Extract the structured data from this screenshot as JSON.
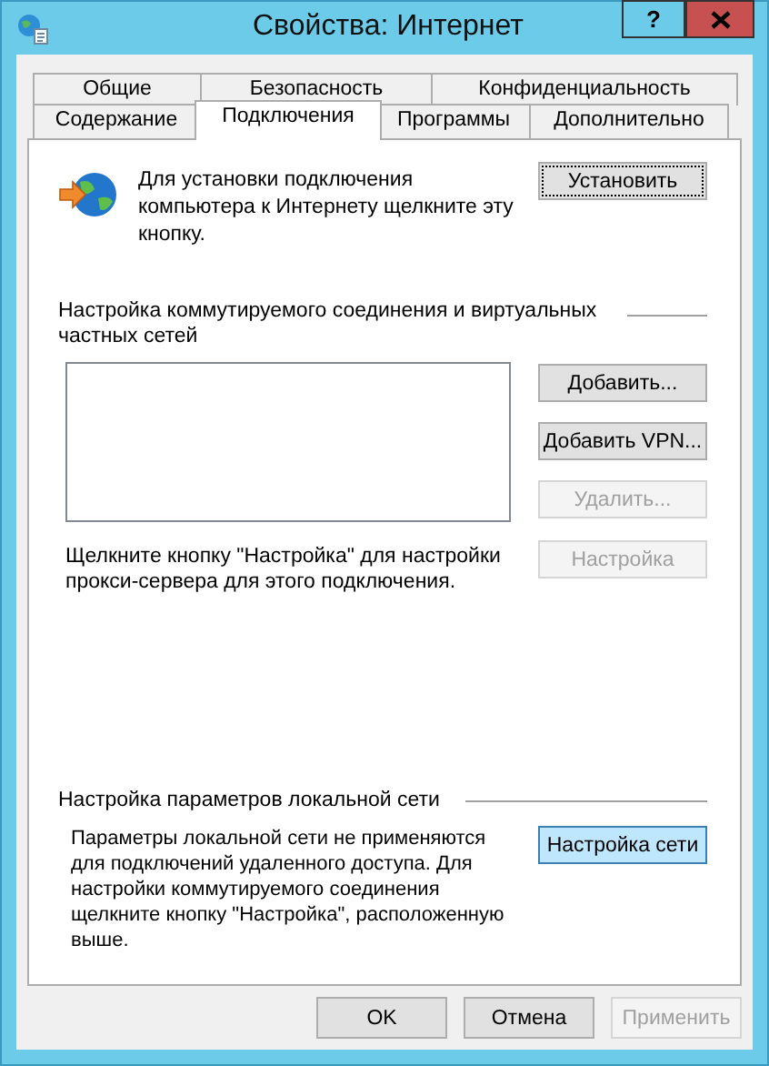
{
  "window": {
    "title": "Свойства: Интернет",
    "help_button": "?"
  },
  "tab_rows": [
    {
      "tabs": [
        {
          "label": "Общие",
          "selected": false
        },
        {
          "label": "Безопасность",
          "selected": false
        },
        {
          "label": "Конфиденциальность",
          "selected": false
        }
      ]
    },
    {
      "tabs": [
        {
          "label": "Содержание",
          "selected": false
        },
        {
          "label": "Подключения",
          "selected": true
        },
        {
          "label": "Программы",
          "selected": false
        },
        {
          "label": "Дополнительно",
          "selected": false
        }
      ]
    }
  ],
  "setup": {
    "text": "Для установки подключения компьютера к Интернету щелкните эту кнопку.",
    "button": {
      "label": "Установить",
      "focused": true
    }
  },
  "dialup": {
    "heading": "Настройка коммутируемого соединения и виртуальных частных сетей",
    "buttons": [
      {
        "label": "Добавить...",
        "disabled": false
      },
      {
        "label": "Добавить VPN...",
        "disabled": false
      },
      {
        "label": "Удалить...",
        "disabled": true
      }
    ],
    "proxy_text": "Щелкните кнопку \"Настройка\" для настройки прокси-сервера для этого подключения.",
    "settings_button": {
      "label": "Настройка",
      "disabled": true
    }
  },
  "lan": {
    "heading": "Настройка параметров локальной сети",
    "text": "Параметры локальной сети не применяются для подключений удаленного доступа. Для настройки коммутируемого соединения щелкните кнопку \"Настройка\", расположенную выше.",
    "button": {
      "label": "Настройка сети",
      "hot": true
    }
  },
  "footer_buttons": [
    {
      "label": "OK",
      "disabled": false
    },
    {
      "label": "Отмена",
      "disabled": false
    },
    {
      "label": "Применить",
      "disabled": true
    }
  ]
}
